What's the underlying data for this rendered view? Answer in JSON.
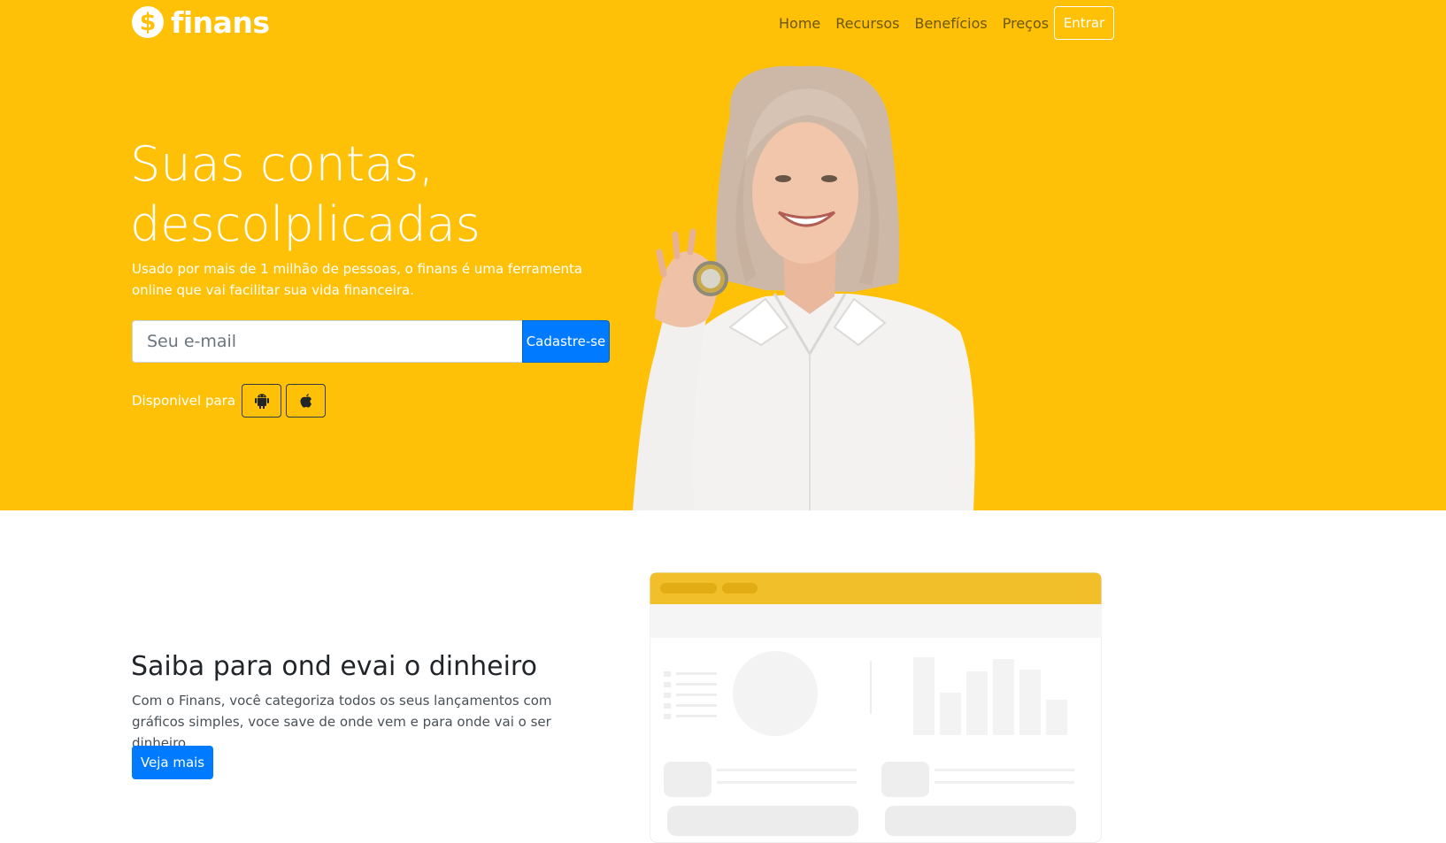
{
  "brand": {
    "logo_symbol": "$",
    "name": "finans",
    "color": "#ffc107"
  },
  "nav": {
    "items": [
      "Home",
      "Recursos",
      "Benefícios",
      "Preços"
    ],
    "login_label": "Entrar"
  },
  "hero": {
    "title_line1": "Suas contas,",
    "title_line2": "descolplicadas",
    "subtitle": "Usado por mais de 1 milhão de pessoas, o finans é uma ferramenta online que vai facilitar sua vida financeira.",
    "email_placeholder": "Seu e-mail",
    "signup_label": "Cadastre-se",
    "available_label": "Disponivel para",
    "stores": [
      "android-icon",
      "apple-icon"
    ]
  },
  "feature": {
    "title": "Saiba para ond evai o dinheiro",
    "text": "Com o Finans, você categoriza todos os seus lançamentos com gráficos simples, voce save de onde vem e para onde vai o ser dinheiro.",
    "button_label": "Veja mais"
  },
  "colors": {
    "primary": "#007bff",
    "hero_bg": "#ffc107",
    "mockup_header": "#f0bf2a"
  }
}
